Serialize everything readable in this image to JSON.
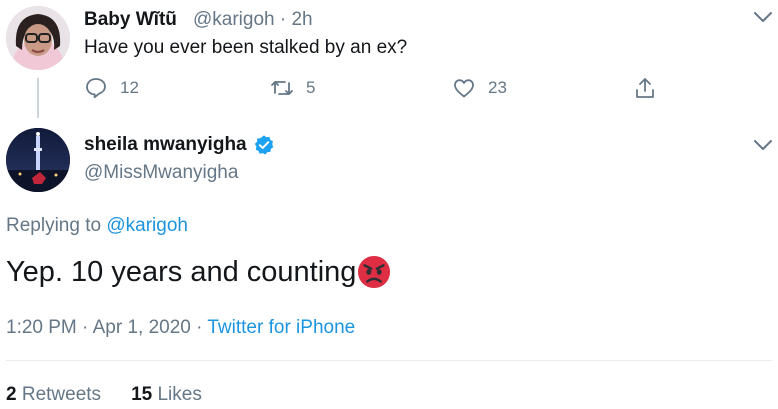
{
  "parent_tweet": {
    "display_name": "Baby Wĩtũ",
    "handle_time": "@karigoh · 2h",
    "text": "Have you ever been stalked by an ex?",
    "actions": {
      "reply_count": "12",
      "retweet_count": "5",
      "like_count": "23"
    },
    "icons": [
      "reply-icon",
      "retweet-icon",
      "like-icon",
      "share-icon",
      "chevron-down-icon"
    ]
  },
  "reply_tweet": {
    "display_name": "sheila mwanyigha",
    "handle": "@MissMwanyigha",
    "replying_prefix": "Replying to",
    "replying_to": "@karigoh",
    "text": "Yep. 10 years and counting",
    "emoji": "angry-face-emoji",
    "timestamp": "1:20 PM · Apr 1, 2020 · ",
    "source": "Twitter for iPhone",
    "stats": {
      "retweets_count": "2",
      "retweets_label": "Retweets",
      "likes_count": "15",
      "likes_label": "Likes"
    }
  },
  "colors": {
    "accent": "#1b95e0",
    "verified": "#1da1f2",
    "muted": "#657786",
    "text": "#14171a"
  }
}
